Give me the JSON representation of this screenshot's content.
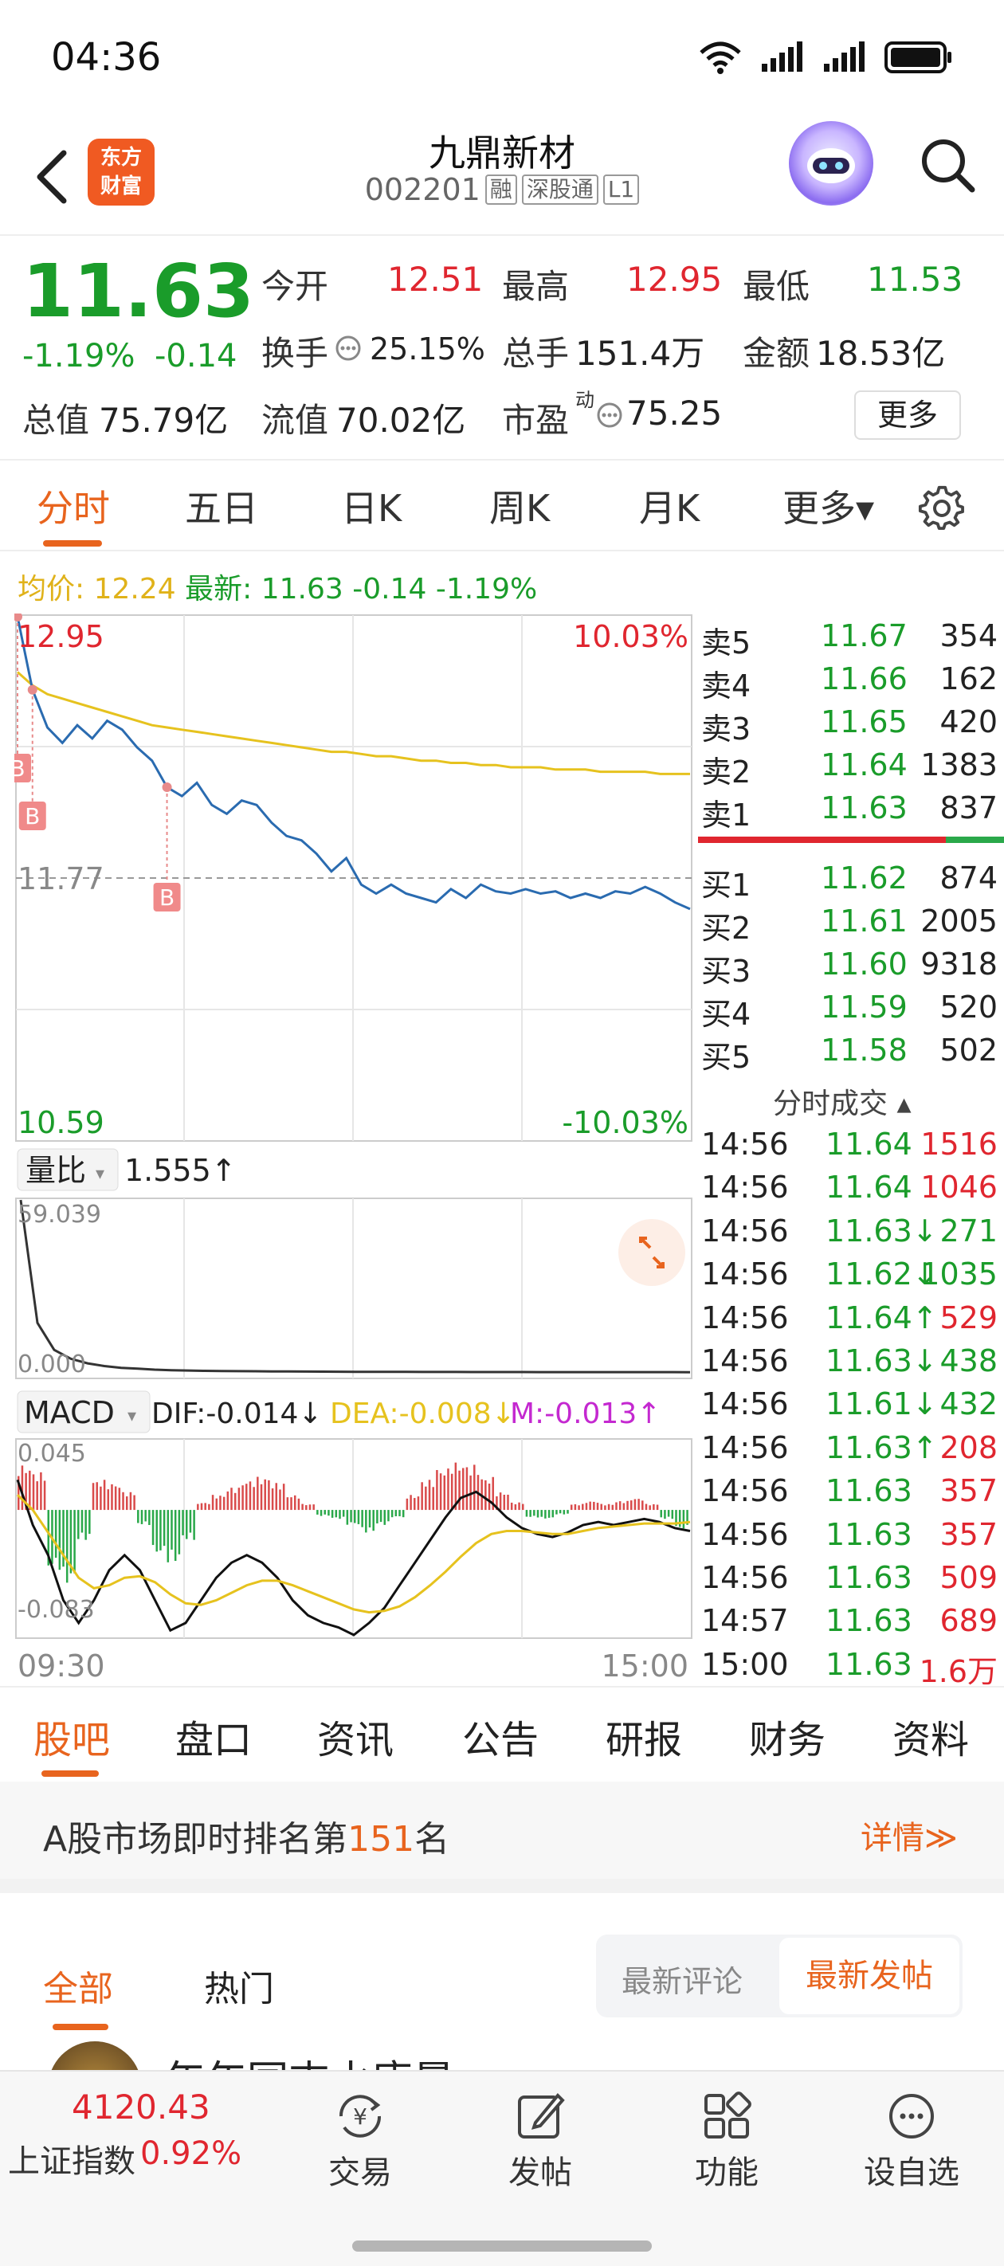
{
  "status_bar": {
    "time": "04:36",
    "icons": [
      "wifi-icon",
      "signal-icon",
      "signal-icon",
      "battery-icon"
    ]
  },
  "header": {
    "brand": "东方\n财富",
    "brand_line1": "东方",
    "brand_line2": "财富",
    "stock_name": "九鼎新材",
    "stock_code": "002201",
    "tags": [
      "融",
      "深股通",
      "L1"
    ]
  },
  "quote": {
    "last_price": "11.63",
    "pct_change": "-1.19%",
    "abs_change": "-0.14",
    "open_label": "今开",
    "open": "12.51",
    "high_label": "最高",
    "high": "12.95",
    "low_label": "最低",
    "low": "11.53",
    "turnover_label": "换手",
    "turnover": "25.15%",
    "volume_label": "总手",
    "volume": "151.4万",
    "amount_label": "金额",
    "amount": "18.53亿",
    "mcap_label": "总值",
    "mcap": "75.79亿",
    "float_label": "流值",
    "float_cap": "70.02亿",
    "pe_label": "市盈",
    "pe_sup": "动",
    "pe": "75.25",
    "more_label": "更多"
  },
  "chart_tabs": [
    "分时",
    "五日",
    "日K",
    "周K",
    "月K",
    "更多▾"
  ],
  "avg_line": {
    "avg_label": "均价:",
    "avg": "12.24",
    "latest_label": "最新:",
    "latest": "11.63",
    "chg": "-0.14",
    "pct": "-1.19%"
  },
  "chart_labels": {
    "top_price": "12.95",
    "top_pct": "10.03%",
    "ref_price": "11.77",
    "bottom_price": "10.59",
    "bottom_pct": "-10.03%",
    "vol_ratio_label": "量比",
    "vol_ratio": "1.555↑",
    "vol_ratio_max": "59.039",
    "vol_ratio_min": "0.000",
    "macd_label": "MACD",
    "dif": "DIF:-0.014↓",
    "dea": "DEA:-0.008↓",
    "m": "M:-0.013↑",
    "macd_max": "0.045",
    "macd_min": "-0.083",
    "time_start": "09:30",
    "time_end": "15:00",
    "buy_marker": "B"
  },
  "chart_data": [
    {
      "type": "line",
      "title": "分时",
      "x_range": [
        "09:30",
        "15:00"
      ],
      "ylim": [
        10.59,
        12.95
      ],
      "reference_price": 11.77,
      "series": [
        {
          "name": "最新",
          "color": "#2a6bb0",
          "values": [
            12.95,
            12.62,
            12.45,
            12.38,
            12.46,
            12.4,
            12.48,
            12.44,
            12.36,
            12.3,
            12.18,
            12.14,
            12.2,
            12.1,
            12.06,
            12.12,
            12.1,
            12.02,
            11.96,
            11.94,
            11.88,
            11.8,
            11.86,
            11.74,
            11.7,
            11.74,
            11.7,
            11.68,
            11.66,
            11.72,
            11.68,
            11.74,
            11.71,
            11.7,
            11.72,
            11.7,
            11.71,
            11.68,
            11.7,
            11.68,
            11.71,
            11.7,
            11.73,
            11.7,
            11.66,
            11.63
          ]
        },
        {
          "name": "均价",
          "color": "#e6c21e",
          "values": [
            12.7,
            12.64,
            12.6,
            12.58,
            12.56,
            12.54,
            12.52,
            12.5,
            12.48,
            12.46,
            12.45,
            12.44,
            12.43,
            12.42,
            12.41,
            12.4,
            12.39,
            12.38,
            12.37,
            12.36,
            12.35,
            12.34,
            12.34,
            12.33,
            12.32,
            12.32,
            12.31,
            12.3,
            12.3,
            12.29,
            12.29,
            12.28,
            12.28,
            12.27,
            12.27,
            12.27,
            12.26,
            12.26,
            12.26,
            12.25,
            12.25,
            12.25,
            12.25,
            12.24,
            12.24,
            12.24
          ]
        }
      ]
    },
    {
      "type": "line",
      "title": "量比",
      "ylim": [
        0.0,
        59.039
      ],
      "series": [
        {
          "name": "量比",
          "color": "#333333",
          "values": [
            59.0,
            18.0,
            9.0,
            6.0,
            4.5,
            3.6,
            3.0,
            2.7,
            2.4,
            2.2,
            2.1,
            2.0,
            1.95,
            1.9,
            1.85,
            1.8,
            1.78,
            1.75,
            1.72,
            1.7,
            1.68,
            1.66,
            1.65,
            1.64,
            1.63,
            1.62,
            1.61,
            1.6,
            1.6,
            1.59,
            1.59,
            1.58,
            1.58,
            1.57,
            1.57,
            1.57,
            1.56,
            1.56,
            1.56,
            1.56,
            1.555
          ]
        }
      ]
    },
    {
      "type": "bar",
      "title": "MACD",
      "ylim": [
        -0.083,
        0.045
      ],
      "series": [
        {
          "name": "M",
          "values": [
            0.03,
            0.025,
            -0.04,
            -0.05,
            -0.02,
            0.02,
            0.018,
            0.012,
            -0.01,
            -0.03,
            -0.035,
            -0.02,
            0.005,
            0.01,
            0.015,
            0.02,
            0.022,
            0.018,
            0.01,
            0.004,
            -0.004,
            -0.006,
            -0.01,
            -0.015,
            -0.01,
            -0.005,
            0.01,
            0.02,
            0.028,
            0.032,
            0.03,
            0.022,
            0.012,
            0.005,
            -0.005,
            -0.006,
            -0.003,
            0.004,
            0.006,
            0.004,
            0.006,
            0.008,
            0.004,
            -0.006,
            -0.013
          ]
        },
        {
          "name": "DIF",
          "color": "#111111",
          "values": [
            0.02,
            -0.01,
            -0.03,
            -0.06,
            -0.075,
            -0.06,
            -0.04,
            -0.03,
            -0.04,
            -0.06,
            -0.08,
            -0.075,
            -0.06,
            -0.045,
            -0.035,
            -0.03,
            -0.035,
            -0.045,
            -0.06,
            -0.07,
            -0.075,
            -0.078,
            -0.083,
            -0.075,
            -0.065,
            -0.05,
            -0.035,
            -0.02,
            -0.005,
            0.008,
            0.012,
            0.005,
            -0.005,
            -0.012,
            -0.016,
            -0.018,
            -0.015,
            -0.01,
            -0.008,
            -0.01,
            -0.008,
            -0.006,
            -0.008,
            -0.012,
            -0.014
          ]
        },
        {
          "name": "DEA",
          "color": "#e6c21e",
          "values": [
            0.01,
            0.0,
            -0.015,
            -0.03,
            -0.045,
            -0.052,
            -0.05,
            -0.045,
            -0.044,
            -0.048,
            -0.056,
            -0.062,
            -0.063,
            -0.06,
            -0.055,
            -0.05,
            -0.047,
            -0.047,
            -0.05,
            -0.054,
            -0.058,
            -0.062,
            -0.066,
            -0.068,
            -0.067,
            -0.064,
            -0.058,
            -0.05,
            -0.041,
            -0.031,
            -0.022,
            -0.016,
            -0.014,
            -0.014,
            -0.015,
            -0.016,
            -0.016,
            -0.014,
            -0.012,
            -0.011,
            -0.01,
            -0.009,
            -0.009,
            -0.009,
            -0.008
          ]
        }
      ]
    }
  ],
  "orderbook": {
    "asks": [
      {
        "label": "卖5",
        "price": "11.67",
        "vol": "354"
      },
      {
        "label": "卖4",
        "price": "11.66",
        "vol": "162"
      },
      {
        "label": "卖3",
        "price": "11.65",
        "vol": "420"
      },
      {
        "label": "卖2",
        "price": "11.64",
        "vol": "1383"
      },
      {
        "label": "卖1",
        "price": "11.63",
        "vol": "837"
      }
    ],
    "bids": [
      {
        "label": "买1",
        "price": "11.62",
        "vol": "874"
      },
      {
        "label": "买2",
        "price": "11.61",
        "vol": "2005"
      },
      {
        "label": "买3",
        "price": "11.60",
        "vol": "9318"
      },
      {
        "label": "买4",
        "price": "11.59",
        "vol": "520"
      },
      {
        "label": "买5",
        "price": "11.58",
        "vol": "502"
      }
    ],
    "ticks_title": "分时成交 ▴",
    "ticks": [
      {
        "time": "14:56",
        "price": "11.64",
        "vol": "1516",
        "dir": "",
        "color": "red"
      },
      {
        "time": "14:56",
        "price": "11.64",
        "vol": "1046",
        "dir": "",
        "color": "red"
      },
      {
        "time": "14:56",
        "price": "11.63↓",
        "vol": "271",
        "dir": "",
        "color": "green"
      },
      {
        "time": "14:56",
        "price": "11.62↓",
        "vol": "1035",
        "dir": "",
        "color": "green"
      },
      {
        "time": "14:56",
        "price": "11.64↑",
        "vol": "529",
        "dir": "",
        "color": "red"
      },
      {
        "time": "14:56",
        "price": "11.63↓",
        "vol": "438",
        "dir": "",
        "color": "green"
      },
      {
        "time": "14:56",
        "price": "11.61↓",
        "vol": "432",
        "dir": "",
        "color": "green"
      },
      {
        "time": "14:56",
        "price": "11.63↑",
        "vol": "208",
        "dir": "",
        "color": "red"
      },
      {
        "time": "14:56",
        "price": "11.63",
        "vol": "357",
        "dir": "",
        "color": "red"
      },
      {
        "time": "14:56",
        "price": "11.63",
        "vol": "357",
        "dir": "",
        "color": "red"
      },
      {
        "time": "14:56",
        "price": "11.63",
        "vol": "509",
        "dir": "",
        "color": "red"
      },
      {
        "time": "14:57",
        "price": "11.63",
        "vol": "689",
        "dir": "",
        "color": "red"
      },
      {
        "time": "15:00",
        "price": "11.63",
        "vol": "1.6万",
        "dir": "",
        "color": "red"
      }
    ]
  },
  "bottom_tabs": [
    "股吧",
    "盘口",
    "资讯",
    "公告",
    "研报",
    "财务",
    "资料"
  ],
  "rank": {
    "prefix": "A股市场即时排名第",
    "rank": "151",
    "suffix": "名",
    "detail": "详情≫"
  },
  "feed": {
    "tab_all": "全部",
    "tab_hot": "热门",
    "sort_comment": "最新评论",
    "sort_post": "最新发帖",
    "peek_text": "年年园吉水唐晨"
  },
  "bottom_nav": {
    "index_value": "4120.43",
    "index_name": "上证指数",
    "index_pct": "0.92%",
    "items": [
      "交易",
      "发帖",
      "功能",
      "设自选"
    ]
  },
  "colors": {
    "up": "#e0262f",
    "down": "#1a9c2a",
    "accent": "#e8641e",
    "price_line": "#2a6bb0",
    "avg_line": "#e6c21e"
  }
}
